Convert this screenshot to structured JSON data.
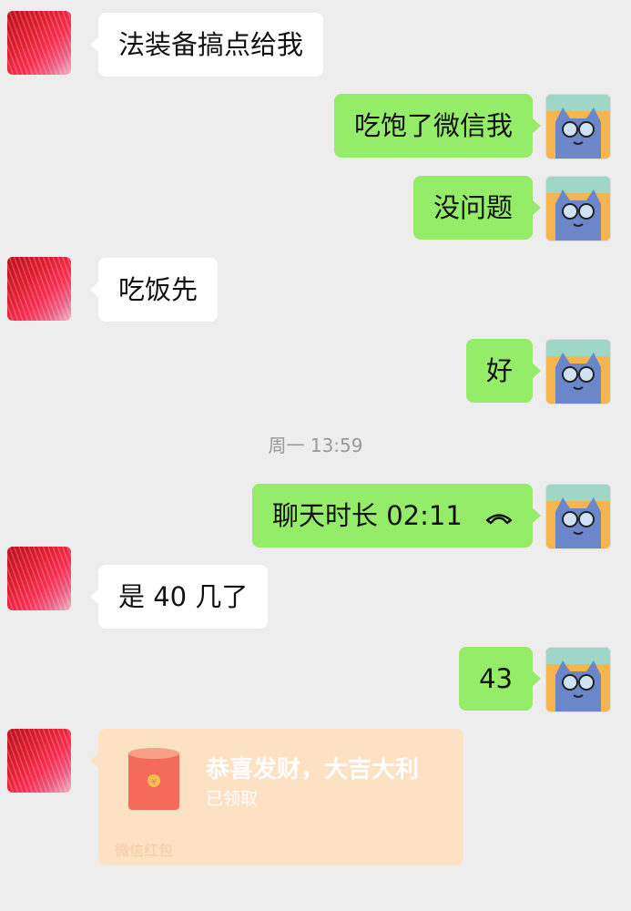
{
  "messages": [
    {
      "side": "in",
      "text": "法装备搞点给我"
    },
    {
      "side": "out",
      "text": "吃饱了微信我"
    },
    {
      "side": "out",
      "text": "没问题"
    },
    {
      "side": "in",
      "text": "吃饭先"
    },
    {
      "side": "out",
      "text": "好"
    },
    {
      "side": "out",
      "text": "聊天时长 02:11"
    },
    {
      "side": "in",
      "text": "是 40 几了"
    },
    {
      "side": "out",
      "text": "43"
    }
  ],
  "timestamp": "周一 13:59",
  "red_packet": {
    "title": "恭喜发财，大吉大利",
    "status": "已领取",
    "footer": "微信红包"
  },
  "icons": {
    "call": "phone-hangup-icon",
    "red_packet": "red-envelope-icon",
    "contact_avatar": "avatar",
    "self_avatar": "cat-with-glasses-avatar"
  },
  "colors": {
    "outgoing_bubble": "#95ec69",
    "incoming_bubble": "#ffffff",
    "background": "#ededed",
    "red_packet_bg": "#fde1c3"
  }
}
